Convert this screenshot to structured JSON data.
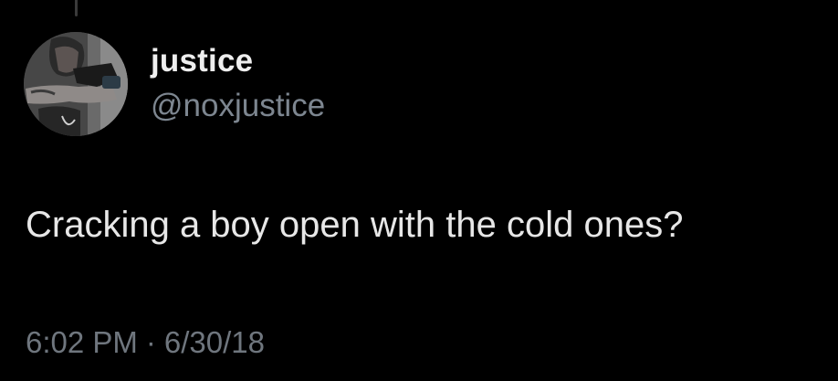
{
  "author": {
    "display_name": "justice",
    "handle": "@noxjustice",
    "avatar_icon": "profile-photo"
  },
  "tweet": {
    "text": "Cracking a boy open with the cold ones?",
    "time": "6:02 PM",
    "separator": "·",
    "date": "6/30/18"
  },
  "colors": {
    "background": "#000000",
    "name": "#eeeeee",
    "handle": "#7d8690",
    "text": "#e7e7e7",
    "meta": "#6f767e"
  }
}
